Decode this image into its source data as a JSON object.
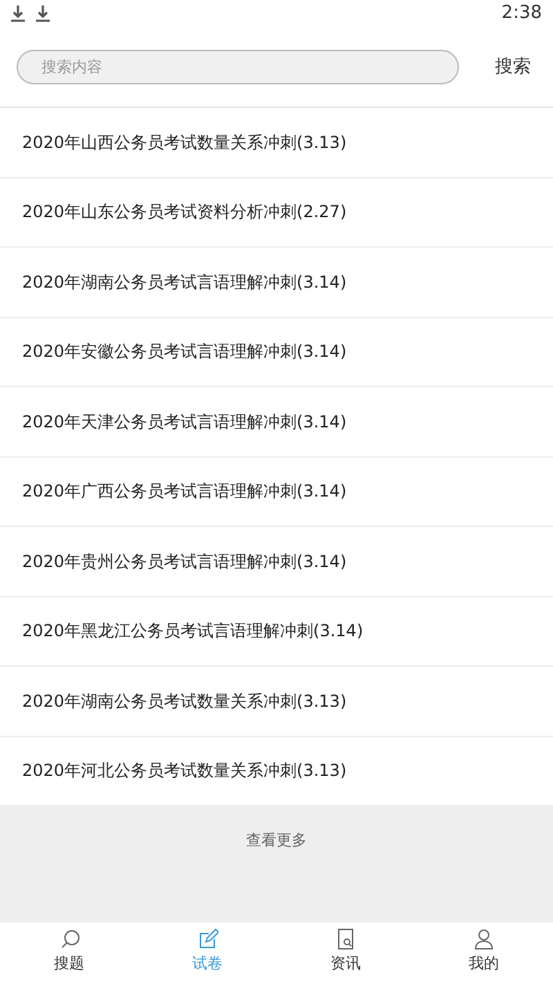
{
  "status_bar": {
    "time": "2:38"
  },
  "search": {
    "placeholder": "搜索内容",
    "button": "搜索"
  },
  "papers": [
    {
      "title": "2020年山西公务员考试数量关系冲刺(3.13)"
    },
    {
      "title": "2020年山东公务员考试资料分析冲刺(2.27)"
    },
    {
      "title": "2020年湖南公务员考试言语理解冲刺(3.14)"
    },
    {
      "title": "2020年安徽公务员考试言语理解冲刺(3.14)"
    },
    {
      "title": "2020年天津公务员考试言语理解冲刺(3.14)"
    },
    {
      "title": "2020年广西公务员考试言语理解冲刺(3.14)"
    },
    {
      "title": "2020年贵州公务员考试言语理解冲刺(3.14)"
    },
    {
      "title": "2020年黑龙江公务员考试言语理解冲刺(3.14)"
    },
    {
      "title": "2020年湖南公务员考试数量关系冲刺(3.13)"
    },
    {
      "title": "2020年河北公务员考试数量关系冲刺(3.13)"
    }
  ],
  "load_more": "查看更多",
  "tabs": [
    {
      "label": "搜题",
      "kind": "search",
      "selected": false
    },
    {
      "label": "试卷",
      "kind": "paper",
      "selected": true
    },
    {
      "label": "资讯",
      "kind": "news",
      "selected": false
    },
    {
      "label": "我的",
      "kind": "profile",
      "selected": false
    }
  ]
}
